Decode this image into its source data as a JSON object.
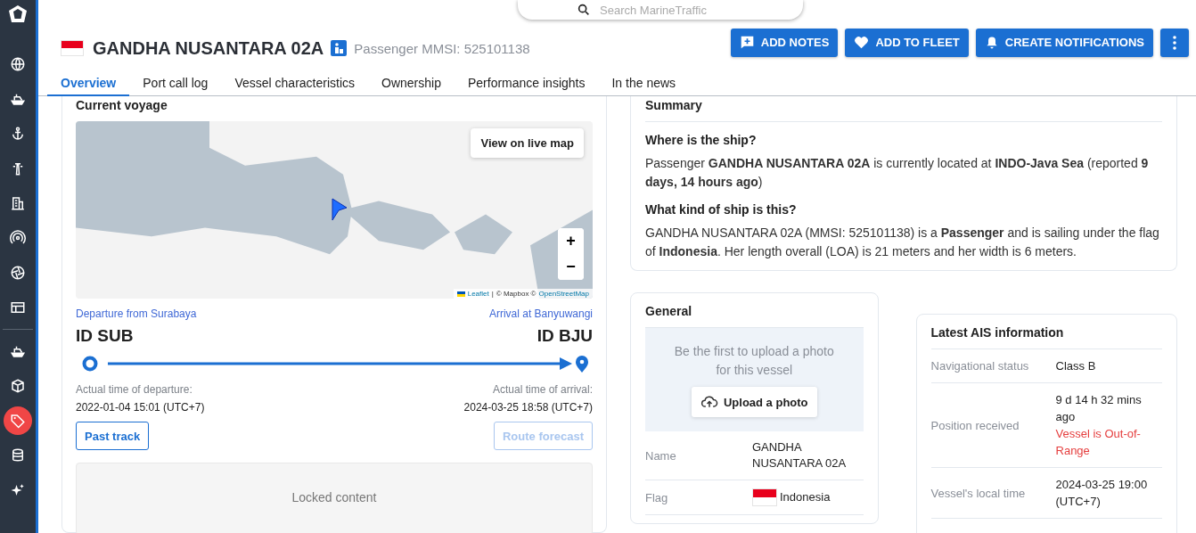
{
  "search": {
    "placeholder": "Search MarineTraffic"
  },
  "vessel": {
    "name": "GANDHA NUSANTARA 02A",
    "subtitle": "Passenger MMSI: 525101138"
  },
  "actions": [
    {
      "kind": "notes",
      "label": "ADD NOTES"
    },
    {
      "kind": "fleet",
      "label": "ADD TO FLEET"
    },
    {
      "kind": "bell",
      "label": "CREATE NOTIFICATIONS"
    },
    {
      "kind": "more"
    }
  ],
  "tabs": [
    {
      "label": "Overview",
      "selected": true
    },
    {
      "label": "Port call log",
      "selected": false
    },
    {
      "label": "Vessel characteristics",
      "selected": false
    },
    {
      "label": "Ownership",
      "selected": false
    },
    {
      "label": "Performance insights",
      "selected": false
    },
    {
      "label": "In the news",
      "selected": false
    }
  ],
  "voyage": {
    "title": "Current voyage",
    "map_button": "View on live map",
    "zoom_in": "+",
    "zoom_out": "−",
    "attribution": [
      "Leaflet",
      "|",
      "© Mapbox ©",
      "OpenStreetMap"
    ],
    "departure_label": "Departure from Surabaya",
    "arrival_label": "Arrival at Banyuwangi",
    "departure_code": "ID SUB",
    "arrival_code": "ID BJU",
    "departure_time_label": "Actual time of departure:",
    "departure_time": "2022-01-04 15:01 (UTC+7)",
    "arrival_time_label": "Actual time of arrival:",
    "arrival_time": "2024-03-25 18:58 (UTC+7)",
    "buttons": [
      {
        "label": "Past track",
        "disabled": false
      },
      {
        "label": "Route forecast",
        "disabled": true
      }
    ],
    "locked": "Locked content"
  },
  "summary": {
    "title": "Summary",
    "sections": [
      {
        "heading": "Where is the ship?",
        "text": "Passenger **GANDHA NUSANTARA 02A** is currently located at **INDO-Java Sea** (reported **9 days, 14 hours ago**)"
      },
      {
        "heading": "What kind of ship is this?",
        "text": "GANDHA NUSANTARA 02A (MMSI: 525101138) is a **Passenger** and is sailing under the flag of **Indonesia**. Her length overall (LOA) is 21 meters and her width is 6 meters."
      }
    ]
  },
  "general": {
    "title": "General",
    "photo_text": "Be the first to upload a photo for this vessel",
    "upload_button": "Upload a photo",
    "rows": [
      {
        "label": "Name",
        "value": "GANDHA NUSANTARA 02A",
        "flag": false
      },
      {
        "label": "Flag",
        "value": "Indonesia",
        "flag": true
      }
    ]
  },
  "ais": {
    "title": "Latest AIS information",
    "rows": [
      {
        "label": "Navigational status",
        "value": "Class B"
      },
      {
        "label": "Position received",
        "value": "9 d 14 h 32 mins ago",
        "alert": "Vessel is Out-of-Range"
      },
      {
        "label": "Vessel's local time",
        "value": "2024-03-25 19:00 (UTC+7)"
      }
    ]
  }
}
